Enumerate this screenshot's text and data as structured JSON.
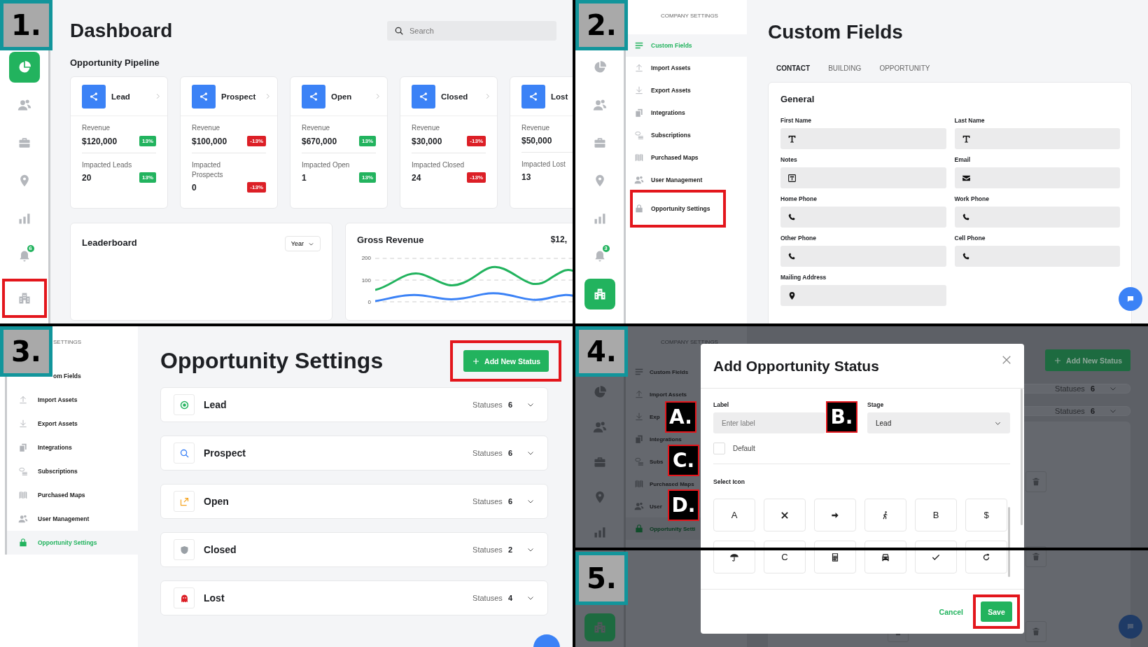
{
  "dashboard": {
    "step": "1.",
    "rail": [
      {
        "kind": "pie",
        "selected": true,
        "highlighted": false
      },
      {
        "kind": "users",
        "selected": false,
        "highlighted": false
      },
      {
        "kind": "briefcase",
        "selected": false,
        "highlighted": false
      },
      {
        "kind": "pin",
        "selected": false,
        "highlighted": false
      },
      {
        "kind": "chart",
        "selected": false,
        "highlighted": false
      },
      {
        "kind": "bell",
        "badge": "6",
        "selected": false,
        "highlighted": false
      },
      {
        "kind": "building",
        "selected": false,
        "highlighted": true
      }
    ],
    "title": "Dashboard",
    "search": {
      "placeholder": "Search"
    },
    "pipeline_title": "Opportunity Pipeline",
    "pipeline": [
      {
        "name": "Lead",
        "revenue_label": "Revenue",
        "revenue": "$120,000",
        "arrow": true,
        "revenue_change": "13%",
        "revenue_negative": false,
        "impact_label": "Impacted Leads",
        "impact": "20",
        "impact_change": "13%",
        "impact_negative": false
      },
      {
        "name": "Prospect",
        "revenue_label": "Revenue",
        "revenue": "$100,000",
        "arrow": true,
        "revenue_change": "-13%",
        "revenue_negative": true,
        "impact_label": "Impacted Prospects",
        "impact": "0",
        "impact_change": "-13%",
        "impact_negative": true
      },
      {
        "name": "Open",
        "revenue_label": "Revenue",
        "revenue": "$670,000",
        "arrow": true,
        "revenue_change": "13%",
        "revenue_negative": false,
        "impact_label": "Impacted Open",
        "impact": "1",
        "impact_change": "13%",
        "impact_negative": false
      },
      {
        "name": "Closed",
        "revenue_label": "Revenue",
        "revenue": "$30,000",
        "arrow": true,
        "revenue_change": "-13%",
        "revenue_negative": true,
        "impact_label": "Impacted Closed",
        "impact": "24",
        "impact_change": "-13%",
        "impact_negative": true
      },
      {
        "name": "Lost",
        "revenue_label": "Revenue",
        "revenue": "$50,000",
        "impact_label": "Impacted Lost",
        "impact": "13"
      }
    ],
    "leaderboard": {
      "title": "Leaderboard",
      "period": "Year"
    },
    "gross_revenue": {
      "title": "Gross Revenue",
      "total": "$12,",
      "y_ticks": [
        "200",
        "100",
        "0"
      ]
    }
  },
  "custom_fields": {
    "step": "2.",
    "rail": [
      {
        "kind": "pie",
        "selected": false
      },
      {
        "kind": "users",
        "selected": false
      },
      {
        "kind": "briefcase",
        "selected": false
      },
      {
        "kind": "pin",
        "selected": false
      },
      {
        "kind": "chart",
        "selected": false
      },
      {
        "kind": "bell",
        "badge": "3",
        "selected": false
      },
      {
        "kind": "building",
        "selected": true
      }
    ],
    "menu_heading": "COMPANY SETTINGS",
    "menu": [
      {
        "label": "Custom Fields",
        "kind": "lines",
        "selected": true,
        "highlighted": false
      },
      {
        "label": "Import Assets",
        "kind": "upload",
        "selected": false,
        "highlighted": false
      },
      {
        "label": "Export Assets",
        "kind": "download",
        "selected": false,
        "highlighted": false
      },
      {
        "label": "Integrations",
        "kind": "copy",
        "selected": false,
        "highlighted": false
      },
      {
        "label": "Subscriptions",
        "kind": "coins",
        "selected": false,
        "highlighted": false
      },
      {
        "label": "Purchased Maps",
        "kind": "map",
        "selected": false,
        "highlighted": false
      },
      {
        "label": "User Management",
        "kind": "users",
        "selected": false,
        "highlighted": false
      },
      {
        "label": "Opportunity Settings",
        "kind": "bag",
        "selected": false,
        "highlighted": true
      }
    ],
    "title": "Custom Fields",
    "tabs": [
      {
        "label": "CONTACT",
        "selected": true
      },
      {
        "label": "BUILDING",
        "selected": false
      },
      {
        "label": "OPPORTUNITY",
        "selected": false
      }
    ],
    "section": "General",
    "fields": [
      {
        "label": "First Name",
        "kind": "text"
      },
      {
        "label": "Last Name",
        "kind": "text"
      },
      {
        "label": "Notes",
        "kind": "textbox"
      },
      {
        "label": "Email",
        "kind": "mail"
      },
      {
        "label": "Home Phone",
        "kind": "phone"
      },
      {
        "label": "Work Phone",
        "kind": "phone"
      },
      {
        "label": "Other Phone",
        "kind": "phone"
      },
      {
        "label": "Cell Phone",
        "kind": "phone"
      },
      {
        "label": "Mailing Address",
        "kind": "pin"
      }
    ]
  },
  "opportunity_settings": {
    "step": "3.",
    "menu_heading": "SETTINGS",
    "menu": [
      {
        "label": "om Fields",
        "selected": false
      },
      {
        "label": "Import Assets",
        "kind": "upload",
        "selected": false
      },
      {
        "label": "Export Assets",
        "kind": "download",
        "selected": false
      },
      {
        "label": "Integrations",
        "kind": "copy",
        "selected": false
      },
      {
        "label": "Subscriptions",
        "kind": "coins",
        "selected": false
      },
      {
        "label": "Purchased Maps",
        "kind": "map",
        "selected": false
      },
      {
        "label": "User Management",
        "kind": "users",
        "selected": false
      },
      {
        "label": "Opportunity Settings",
        "kind": "bag",
        "selected": true
      }
    ],
    "title": "Opportunity Settings",
    "add_button": {
      "label": "Add New Status",
      "highlighted": true
    },
    "stages": [
      {
        "name": "Lead",
        "kind": "target",
        "color": "#22b35e",
        "count_label": "Statuses",
        "count": "6"
      },
      {
        "name": "Prospect",
        "kind": "search",
        "color": "#3b82f6",
        "count_label": "Statuses",
        "count": "6"
      },
      {
        "name": "Open",
        "kind": "external",
        "color": "#f5a524",
        "count_label": "Statuses",
        "count": "6"
      },
      {
        "name": "Closed",
        "kind": "shield",
        "color": "#9aa0a6",
        "count_label": "Statuses",
        "count": "2"
      },
      {
        "name": "Lost",
        "kind": "ghost",
        "color": "#dc1f26",
        "count_label": "Statuses",
        "count": "4"
      }
    ]
  },
  "add_status": {
    "step": "4.",
    "lower_step": "5.",
    "rail": [
      {
        "kind": "pie",
        "selected": false
      },
      {
        "kind": "users",
        "selected": false
      },
      {
        "kind": "briefcase",
        "selected": false
      },
      {
        "kind": "pin",
        "selected": false
      },
      {
        "kind": "chart",
        "selected": false
      },
      {
        "kind": "building",
        "selected": true
      }
    ],
    "menu_heading": "COMPANY SETTINGS",
    "menu": [
      {
        "label": "Custom Fields",
        "kind": "lines",
        "selected": false
      },
      {
        "label": "Import Assets",
        "kind": "upload",
        "selected": false
      },
      {
        "label": "Exp",
        "kind": "download",
        "selected": false
      },
      {
        "label": "Integrations",
        "kind": "copy",
        "selected": false
      },
      {
        "label": "Subs",
        "kind": "coins",
        "selected": false
      },
      {
        "label": "Purchased Maps",
        "kind": "map",
        "selected": false
      },
      {
        "label": "User",
        "kind": "users",
        "selected": false
      },
      {
        "label": "Opportunity Setti",
        "kind": "bag",
        "selected": true
      }
    ],
    "add_button": "Add New Status",
    "rows": [
      {
        "count_label": "Statuses",
        "count": "6"
      },
      {
        "count_label": "Statuses",
        "count": "6"
      }
    ],
    "modal": {
      "title": "Add Opportunity Status",
      "label_field": {
        "label": "Label",
        "placeholder": "Enter label"
      },
      "stage_field": {
        "label": "Stage",
        "value": "Lead"
      },
      "default": {
        "label": "Default",
        "checked": false
      },
      "icon_heading": "Select Icon",
      "icons": [
        {
          "kind": "letter",
          "glyph": "A"
        },
        {
          "kind": "tools"
        },
        {
          "kind": "arrow"
        },
        {
          "kind": "walker"
        },
        {
          "kind": "letter",
          "glyph": "B"
        },
        {
          "kind": "letter",
          "glyph": "$"
        },
        {
          "kind": "umbrella"
        },
        {
          "kind": "letter",
          "glyph": "C"
        },
        {
          "kind": "calculator"
        },
        {
          "kind": "car"
        },
        {
          "kind": "check"
        },
        {
          "kind": "reload"
        }
      ],
      "cancel": "Cancel",
      "save": {
        "label": "Save",
        "highlighted": true
      }
    },
    "callouts": [
      "A.",
      "B.",
      "C.",
      "D."
    ]
  }
}
